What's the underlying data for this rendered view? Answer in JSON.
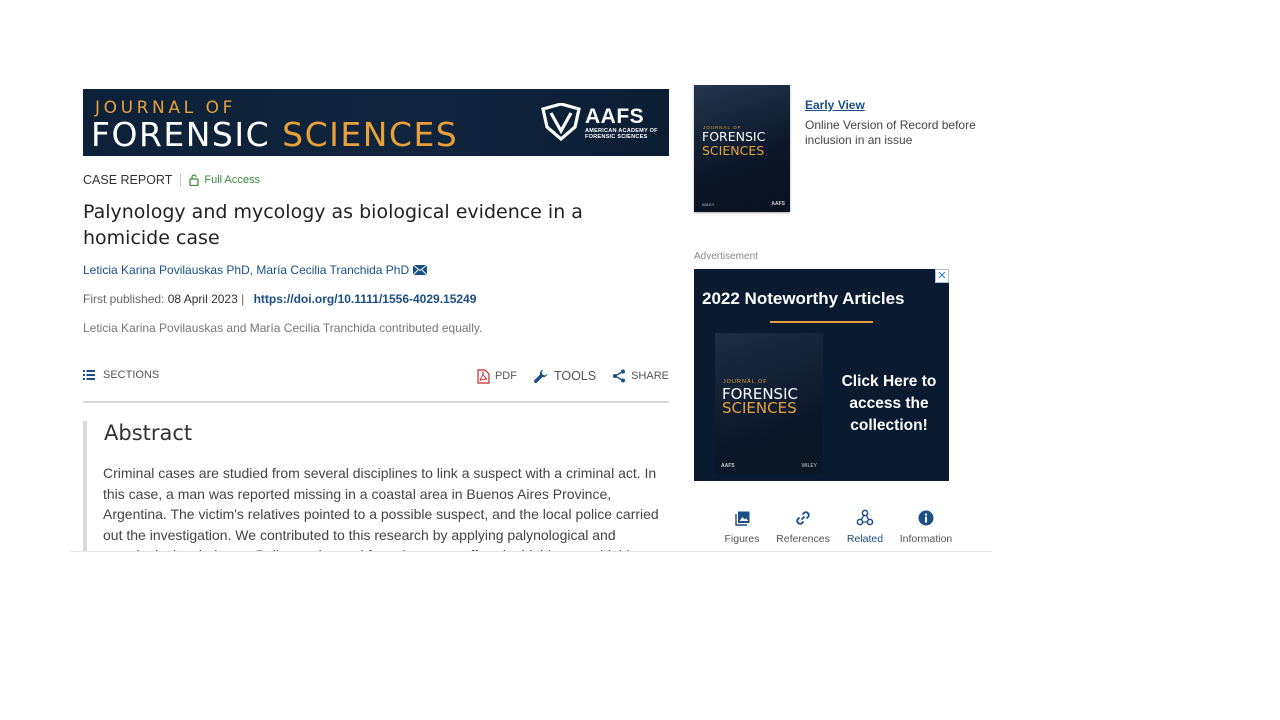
{
  "journal": {
    "banner_line1": "JOURNAL OF",
    "banner_word1": "FORENSIC",
    "banner_word2": "SCIENCES",
    "publisher_logo": "AAFS",
    "publisher_tagline_1": "AMERICAN ACADEMY OF",
    "publisher_tagline_2": "FORENSIC SCIENCES"
  },
  "article": {
    "type": "CASE REPORT",
    "access": "Full Access",
    "title": "Palynology and mycology as biological evidence in a homicide case",
    "authors": "Leticia Karina Povilauskas PhD, María Cecilia Tranchida PhD",
    "first_published_label": "First published:",
    "first_published_date": "08 April 2023",
    "separator": "|",
    "doi": "https://doi.org/10.1111/1556-4029.15249",
    "contribution_note": "Leticia Karina Povilauskas and María Cecilia Tranchida contributed equally."
  },
  "toolbar": {
    "sections": "SECTIONS",
    "pdf": "PDF",
    "tools": "TOOLS",
    "share": "SHARE"
  },
  "abstract": {
    "heading": "Abstract",
    "text": "Criminal cases are studied from several disciplines to link a suspect with a criminal act. In this case, a man was reported missing in a coastal area in Buenos Aires Province, Argentina. The victim's relatives pointed to a possible suspect, and the local police carried out the investigation. We contributed to this research by applying palynological and mycological techniques. Pollen grains and fungal spores suffered a highly unavoidable"
  },
  "sidebar": {
    "cover_line1": "JOURNAL OF",
    "cover_word1": "FORENSIC",
    "cover_word2": "SCIENCES",
    "cover_publisher": "WILEY",
    "cover_logo": "AAFS",
    "early_view_link": "Early View",
    "early_view_desc": "Online Version of Record before inclusion in an issue",
    "ad_label": "Advertisement",
    "ad_close": "✕",
    "ad_heading": "2022 Noteworthy Articles",
    "ad_cta": "Click Here to access the collection!",
    "tabs": [
      {
        "label": "Figures",
        "icon": "image-icon"
      },
      {
        "label": "References",
        "icon": "link-icon"
      },
      {
        "label": "Related",
        "icon": "related-icon"
      },
      {
        "label": "Information",
        "icon": "info-icon"
      }
    ]
  },
  "colors": {
    "brand_navy": "#10243d",
    "brand_gold": "#e8a13a",
    "link_blue": "#1b4f86",
    "access_green": "#3a8a3f"
  }
}
